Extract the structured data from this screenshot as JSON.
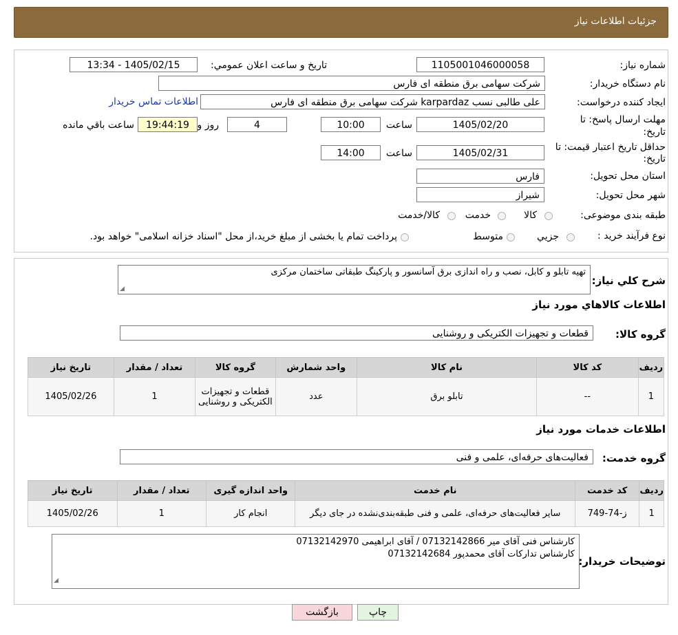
{
  "header": {
    "title": "جزئیات اطلاعات نیاز"
  },
  "form": {
    "need_number_label": "شماره نیاز:",
    "need_number": "1105001046000058",
    "announce_label": "تاریخ و ساعت اعلان عمومي:",
    "announce_value": "1405/02/15 - 13:34",
    "buyer_org_label": "نام دستگاه خريدار:",
    "buyer_org": "شرکت سهامی برق منطقه ای فارس",
    "requester_label": "ايجاد کننده درخواست:",
    "requester": "علی طالبی نسب karpardaz شرکت سهامی برق منطقه ای فارس",
    "contact_link": "اطلاعات تماس خريدار",
    "reply_deadline_label_1": "مهلت ارسال پاسخ: تا",
    "reply_deadline_label_2": "تاريخ:",
    "reply_date": "1405/02/20",
    "time_label": "ساعت",
    "reply_time": "10:00",
    "days_value": "4",
    "days_label": "روز و",
    "remaining_time": "19:44:19",
    "remaining_label": "ساعت باقي مانده",
    "price_validity_label_1": "حداقل تاريخ اعتبار قيمت: تا",
    "price_validity_label_2": "تاريخ:",
    "price_validity_date": "1405/02/31",
    "price_validity_time": "14:00",
    "province_label": "استان محل تحويل:",
    "province": "فارس",
    "city_label": "شهر محل تحويل:",
    "city": "شيراز",
    "category_label": "طبقه بندی موضوعی:",
    "category_options": [
      "کالا",
      "خدمت",
      "کالا/خدمت"
    ],
    "process_label": "نوع فرآيند خريد :",
    "process_options": [
      "جزيي",
      "متوسط"
    ],
    "process_note": "پرداخت تمام يا بخشی از مبلغ خريد،از محل \"اسناد خزانه اسلامی\" خواهد بود."
  },
  "summary": {
    "label": "شرح کلي نياز:",
    "text": "تهیه تابلو و کابل، نصب و راه اندازی برق آسانسور و پارکینگ طبقاتی ساختمان مرکزی"
  },
  "goods": {
    "section_title": "اطلاعات کالاهاي مورد نياز",
    "group_label": "گروه کالا:",
    "group_value": "قطعات و تجهیزات الکتریکی و روشنایی",
    "columns": [
      "رديف",
      "کد کالا",
      "نام کالا",
      "واحد شمارش",
      "گروه کالا",
      "تعداد / مقدار",
      "تاريخ نياز"
    ],
    "rows": [
      {
        "row": "1",
        "code": "--",
        "name": "تابلو برق",
        "unit": "عدد",
        "group": "قطعات و تجهیزات الکتریکی و روشنایی",
        "qty": "1",
        "date": "1405/02/26"
      }
    ]
  },
  "services": {
    "section_title": "اطلاعات خدمات مورد نياز",
    "group_label": "گروه خدمت:",
    "group_value": "فعالیت‌های حرفه‌ای، علمی و فنی",
    "columns": [
      "رديف",
      "کد خدمت",
      "نام خدمت",
      "واحد اندازه گيری",
      "تعداد / مقدار",
      "تاريخ نياز"
    ],
    "rows": [
      {
        "row": "1",
        "code": "ز-74-749",
        "name": "سایر فعالیت‌های حرفه‌ای، علمی و فنی طبقه‌بندی‌نشده در جای دیگر",
        "unit": "انجام کار",
        "qty": "1",
        "date": "1405/02/26"
      }
    ]
  },
  "buyer_notes": {
    "label": "توضيحات خريدار:",
    "line1": "کارشناس فنی آقای میر 07132142866 / آقای ابراهیمی 07132142970",
    "line2": "کارشناس تدارکات آقای محمدپور 07132142684"
  },
  "buttons": {
    "print": "چاپ",
    "back": "بازگشت"
  },
  "watermark": {
    "text": "AriaTender.neT"
  },
  "colors": {
    "header_bg": "#8b6a3c",
    "link": "#1a37b9",
    "remaining_bg": "#ffffcc",
    "back_button_bg": "#f8d7da",
    "print_button_bg": "#e3f5e1"
  }
}
